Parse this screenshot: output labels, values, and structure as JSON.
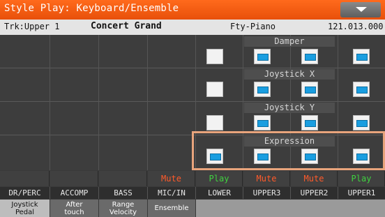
{
  "title": "Style Play: Keyboard/Ensemble",
  "menu_icon": "chevron-down-icon",
  "info": {
    "track": "Trk:Upper 1",
    "sound": "Concert Grand",
    "category": "Fty-Piano",
    "bank": "121.013.000"
  },
  "rows": [
    {
      "label": "Damper",
      "checkboxes": [
        false,
        true,
        true,
        true
      ]
    },
    {
      "label": "Joystick X",
      "checkboxes": [
        false,
        true,
        true,
        true
      ]
    },
    {
      "label": "Joystick Y",
      "checkboxes": [
        false,
        true,
        true,
        true
      ]
    },
    {
      "label": "Expression",
      "checkboxes": [
        true,
        true,
        true,
        true
      ]
    }
  ],
  "mute_play": [
    "",
    "",
    "",
    "Mute",
    "Play",
    "Mute",
    "Mute",
    "Play"
  ],
  "track_names": [
    "DR/PERC",
    "ACCOMP",
    "BASS",
    "MIC/IN",
    "LOWER",
    "UPPER3",
    "UPPER2",
    "UPPER1"
  ],
  "tabs": [
    {
      "line1": "Joystick",
      "line2": "Pedal",
      "active": true
    },
    {
      "line1": "After",
      "line2": "touch",
      "active": false
    },
    {
      "line1": "Range",
      "line2": "Velocity",
      "active": false
    },
    {
      "line1": "Ensemble",
      "line2": "",
      "active": false
    }
  ],
  "colors": {
    "title_bar": "#e8500a",
    "checkbox_on": "#1a9ee0",
    "mute": "#ff5a2a",
    "play": "#3fd23f",
    "highlight": "#e8a47c"
  }
}
